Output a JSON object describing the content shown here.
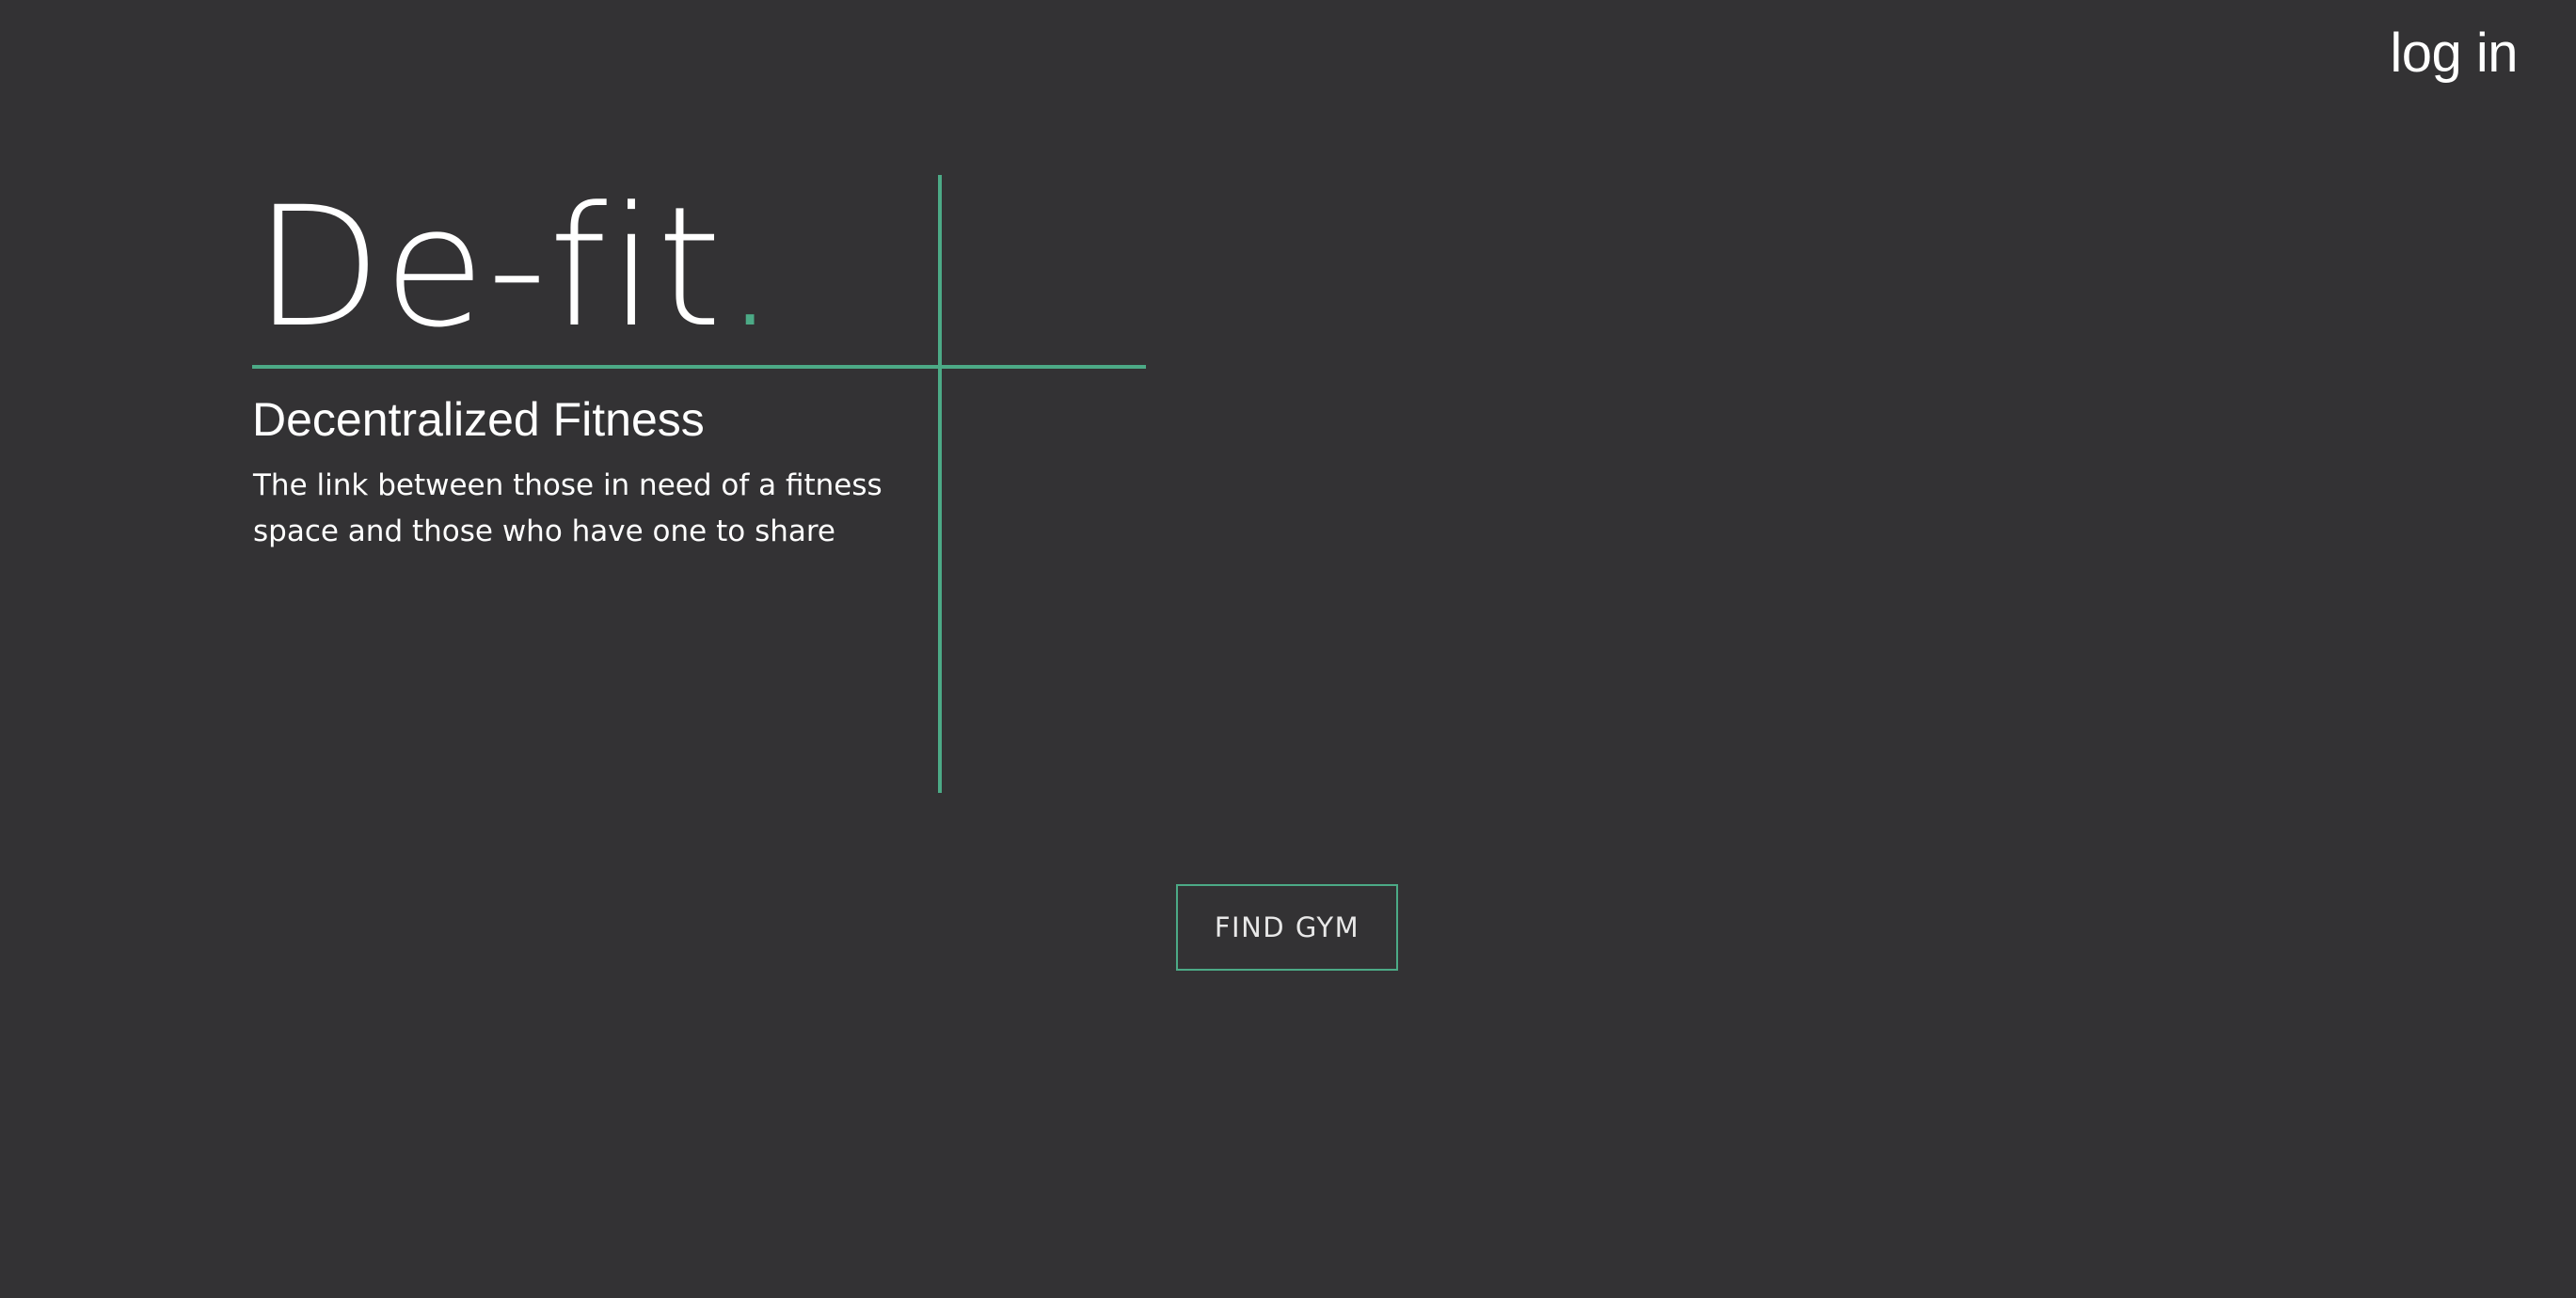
{
  "header": {
    "login_label": "log in"
  },
  "hero": {
    "brand_name": "De-fit",
    "brand_dot": ".",
    "subtitle": "Decentralized Fitness",
    "tagline": "The link between those in need of a fitness space and those who have one to share"
  },
  "actions": {
    "find_gym_label": "FIND GYM"
  },
  "colors": {
    "background": "#333234",
    "accent": "#4caa86",
    "text": "#ffffff"
  }
}
